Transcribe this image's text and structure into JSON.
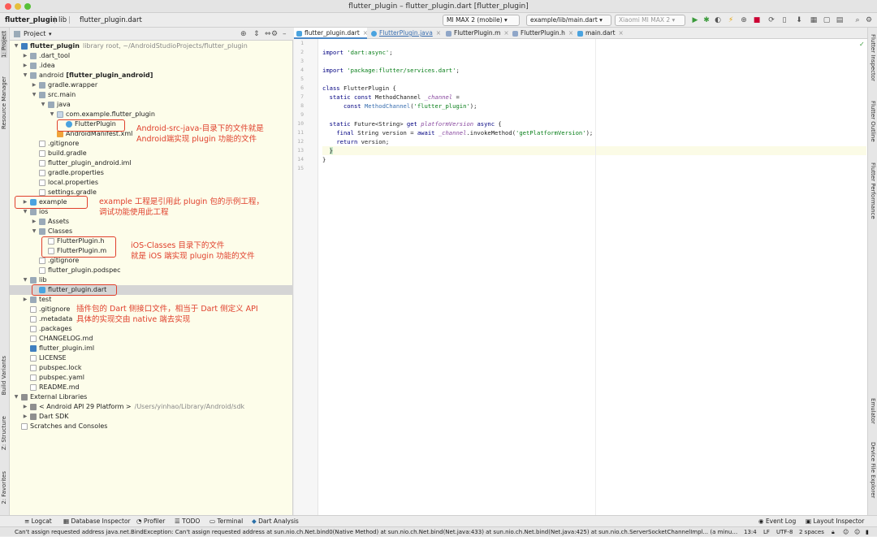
{
  "window": {
    "title": "flutter_plugin – flutter_plugin.dart [flutter_plugin]"
  },
  "breadcrumb": {
    "project": "flutter_plugin",
    "folder": "lib",
    "file": "flutter_plugin.dart"
  },
  "toolbar": {
    "device": "MI MAX 2 (mobile)",
    "run_config": "example/lib/main.dart",
    "emulator": "Xiaomi MI MAX 2"
  },
  "project_panel": {
    "title": "Project",
    "root": {
      "name": "flutter_plugin",
      "hint": "library root, ~/AndroidStudioProjects/flutter_plugin"
    },
    "items": [
      {
        "label": ".dart_tool"
      },
      {
        "label": ".idea"
      },
      {
        "label": "android",
        "suffix": "[flutter_plugin_android]"
      },
      {
        "label": "gradle.wrapper"
      },
      {
        "label": "src.main"
      },
      {
        "label": "java"
      },
      {
        "label": "com.example.flutter_plugin"
      },
      {
        "label": "FlutterPlugin"
      },
      {
        "label": "AndroidManifest.xml"
      },
      {
        "label": ".gitignore"
      },
      {
        "label": "build.gradle"
      },
      {
        "label": "flutter_plugin_android.iml"
      },
      {
        "label": "gradle.properties"
      },
      {
        "label": "local.properties"
      },
      {
        "label": "settings.gradle"
      },
      {
        "label": "example"
      },
      {
        "label": "ios"
      },
      {
        "label": "Assets"
      },
      {
        "label": "Classes"
      },
      {
        "label": "FlutterPlugin.h"
      },
      {
        "label": "FlutterPlugin.m"
      },
      {
        "label": ".gitignore"
      },
      {
        "label": "flutter_plugin.podspec"
      },
      {
        "label": "lib"
      },
      {
        "label": "flutter_plugin.dart"
      },
      {
        "label": "test"
      },
      {
        "label": ".gitignore"
      },
      {
        "label": ".metadata"
      },
      {
        "label": ".packages"
      },
      {
        "label": "CHANGELOG.md"
      },
      {
        "label": "flutter_plugin.iml"
      },
      {
        "label": "LICENSE"
      },
      {
        "label": "pubspec.lock"
      },
      {
        "label": "pubspec.yaml"
      },
      {
        "label": "README.md"
      },
      {
        "label": "External Libraries"
      },
      {
        "label": "< Android API 29 Platform >",
        "hint": "/Users/yinhao/Library/Android/sdk"
      },
      {
        "label": "Dart SDK"
      },
      {
        "label": "Scratches and Consoles"
      }
    ]
  },
  "annotations": {
    "android": [
      "Android-src-java-目录下的文件就是",
      "Android端实现 plugin 功能的文件"
    ],
    "example": [
      "example 工程是引用此 plugin 包的示例工程，",
      "调试功能使用此工程"
    ],
    "ios": [
      "iOS-Classes 目录下的文件",
      "就是 iOS 端实现 plugin 功能的文件"
    ],
    "lib": [
      "插件包的 Dart 侧接口文件，相当于 Dart 侧定义 API",
      "具体的实现交由 native 端去实现"
    ]
  },
  "editor": {
    "tabs": [
      {
        "label": "flutter_plugin.dart"
      },
      {
        "label": "FlutterPlugin.java"
      },
      {
        "label": "FlutterPlugin.m"
      },
      {
        "label": "FlutterPlugin.h"
      },
      {
        "label": "main.dart"
      }
    ],
    "line_numbers": [
      "1",
      "2",
      "3",
      "4",
      "5",
      "6",
      "7",
      "8",
      "9",
      "10",
      "11",
      "12",
      "13",
      "14",
      "15"
    ]
  },
  "left_tool_tabs": [
    "1: Project",
    "Resource Manager",
    "Build Variants",
    "Z: Structure",
    "2: Favorites"
  ],
  "right_tool_tabs": [
    "Flutter Inspector",
    "Flutter Outline",
    "Flutter Performance",
    "Emulator",
    "Device File Explorer"
  ],
  "bottom_tools": {
    "logcat": "Logcat",
    "db": "Database Inspector",
    "profiler": "Profiler",
    "todo": "TODO",
    "terminal": "Terminal",
    "dart": "Dart Analysis",
    "event": "Event Log",
    "layout": "Layout Inspector"
  },
  "status": {
    "message": "Can't assign requested address java.net.BindException: Can't assign requested address at sun.nio.ch.Net.bind0(Native Method) at sun.nio.ch.Net.bind(Net.java:433) at sun.nio.ch.Net.bind(Net.java:425) at sun.nio.ch.ServerSocketChannelImpl... (a minute ago)",
    "position": "13:4",
    "line_sep": "LF",
    "encoding": "UTF-8",
    "indent": "2 spaces"
  },
  "colors": {
    "annotation_red": "#e0402c",
    "panel_bg": "#fdfdea",
    "keyword": "#000080",
    "string": "#067d17"
  }
}
